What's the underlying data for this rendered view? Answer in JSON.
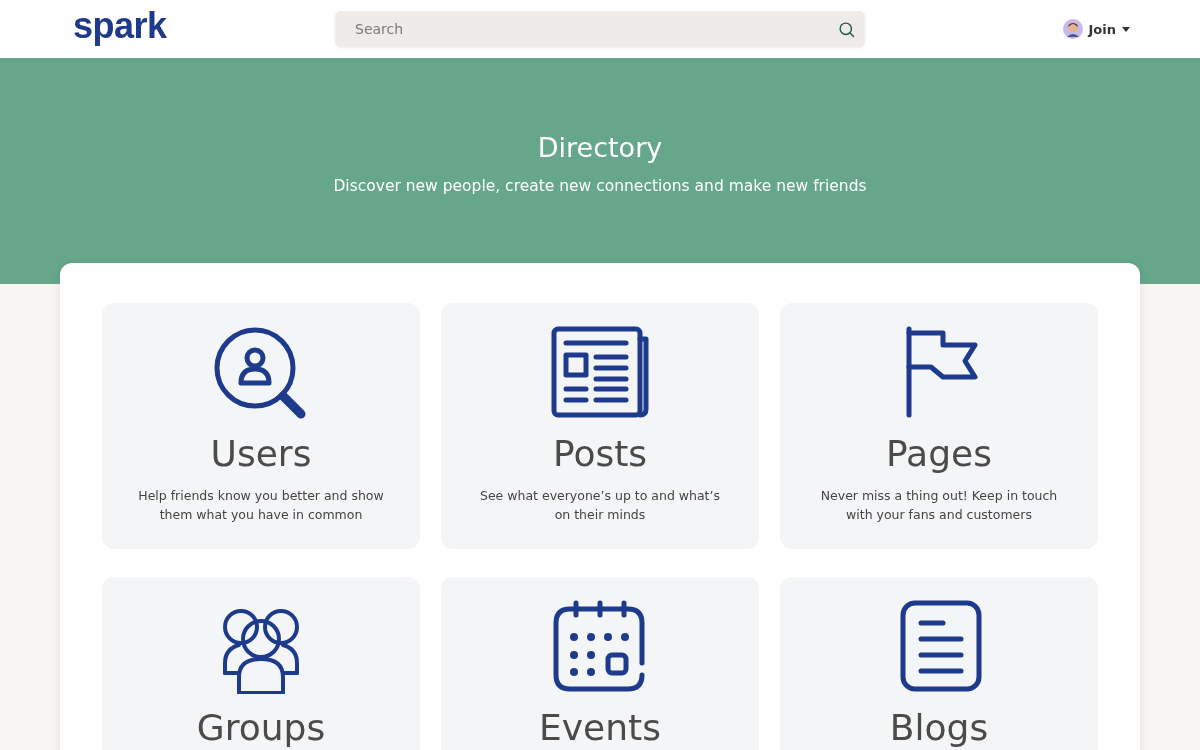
{
  "header": {
    "logo": "spark",
    "search": {
      "placeholder": "Search"
    },
    "account": {
      "label": "Join"
    }
  },
  "hero": {
    "title": "Directory",
    "subtitle": "Discover new people, create new connections and make new friends"
  },
  "cards": [
    {
      "kind": "users",
      "title": "Users",
      "description": "Help friends know you better and show them what you have in common"
    },
    {
      "kind": "posts",
      "title": "Posts",
      "description": "See what everyone’s up to and what’s on their minds"
    },
    {
      "kind": "pages",
      "title": "Pages",
      "description": "Never miss a thing out! Keep in touch with your fans and customers"
    },
    {
      "kind": "groups",
      "title": "Groups"
    },
    {
      "kind": "events",
      "title": "Events"
    },
    {
      "kind": "blogs",
      "title": "Blogs"
    }
  ]
}
